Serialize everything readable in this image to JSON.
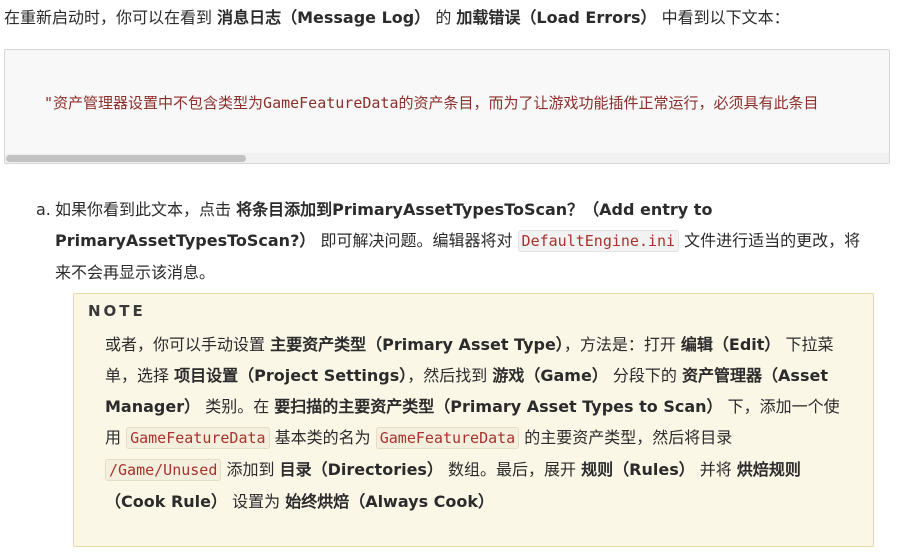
{
  "intro": {
    "t1": "在重新启动时，你可以在看到 ",
    "b1": "消息日志（Message Log）",
    "t2": " 的 ",
    "b2": "加载错误（Load Errors）",
    "t3": " 中看到以下文本："
  },
  "code_block": {
    "line": "\"资产管理器设置中不包含类型为GameFeatureData的资产条目，而为了让游戏功能插件正常运行，必须具有此条目"
  },
  "list_item": {
    "marker": "a.",
    "t1": "如果你看到此文本，点击 ",
    "b1": "将条目添加到PrimaryAssetTypesToScan？（Add entry to PrimaryAssetTypesToScan?）",
    "t2": " 即可解决问题。编辑器将对 ",
    "code1": "DefaultEngine.ini",
    "t3": " 文件进行适当的更改，将来不会再显示该消息。"
  },
  "note": {
    "title": "NOTE",
    "t1": "或者，你可以手动设置 ",
    "b1": "主要资产类型（Primary Asset Type）",
    "t2": "，方法是：打开 ",
    "b2": "编辑（Edit）",
    "t3": " 下拉菜单，选择 ",
    "b3": "项目设置（Project Settings）",
    "t4": "，然后找到 ",
    "b4": "游戏（Game）",
    "t5": " 分段下的 ",
    "b5": "资产管理器（Asset Manager）",
    "t6": " 类别。在 ",
    "b6": "要扫描的主要资产类型（Primary Asset Types to Scan）",
    "t7": " 下，添加一个使用 ",
    "code1": "GameFeatureData",
    "t8": " 基本类的名为 ",
    "code2": "GameFeatureData",
    "t9": " 的主要资产类型，然后将目录 ",
    "code3": "/Game/Unused",
    "t10": " 添加到 ",
    "b7": "目录（Directories）",
    "t11": " 数组。最后，展开 ",
    "b8": "规则（Rules）",
    "t12": " 并将 ",
    "b9": "烘焙规则（Cook Rule）",
    "t13": " 设置为 ",
    "b10": "始终烘焙（Always Cook）"
  }
}
